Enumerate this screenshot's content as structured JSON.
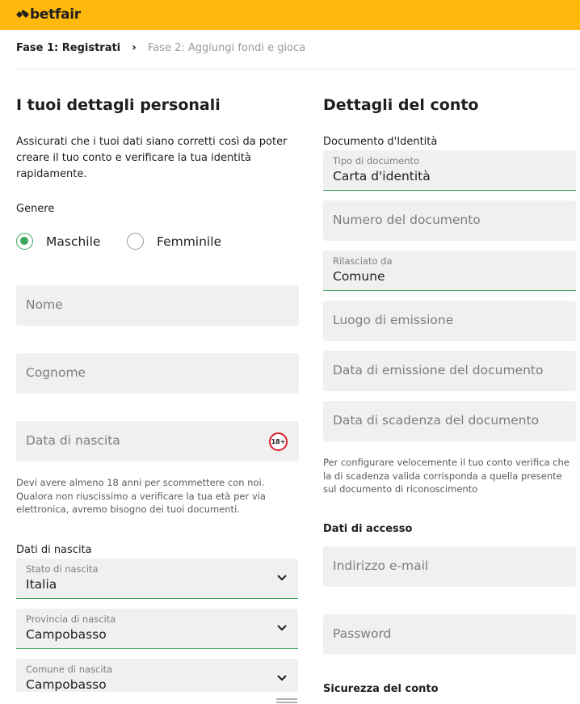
{
  "brand": {
    "name": "betfair"
  },
  "steps": {
    "step1": "Fase 1: Registrati",
    "step2": "Fase 2: Aggiungi fondi e gioca"
  },
  "personal": {
    "title": "I tuoi dettagli personali",
    "intro": "Assicurati che i tuoi dati siano corretti così da poter creare il tuo conto e verificare la tua identità rapidamente.",
    "gender_label": "Genere",
    "gender_options": [
      "Maschile",
      "Femminile"
    ],
    "gender_selected": "Maschile",
    "first_name_placeholder": "Nome",
    "last_name_placeholder": "Cognome",
    "birth_date_placeholder": "Data di nascita",
    "age_badge": "18+",
    "age_note": "Devi avere almeno 18 anni per scommettere con noi. Qualora non riuscissimo a verificare la tua età per via elettronica, avremo bisogno dei tuoi documenti.",
    "birth_data_title": "Dati di nascita",
    "birth_state_label": "Stato di nascita",
    "birth_state_value": "Italia",
    "birth_province_label": "Provincia di nascita",
    "birth_province_value": "Campobasso",
    "birth_city_label": "Comune di nascita",
    "birth_city_value": "Campobasso"
  },
  "account": {
    "title": "Dettagli del conto",
    "doc_section": "Documento d'Identità",
    "doc_type_label": "Tipo di documento",
    "doc_type_value": "Carta d'identità",
    "doc_number_placeholder": "Numero del documento",
    "issued_by_label": "Rilasciato da",
    "issued_by_value": "Comune",
    "issue_place_placeholder": "Luogo di emissione",
    "issue_date_placeholder": "Data di emissione del documento",
    "expiry_date_placeholder": "Data di scadenza del documento",
    "doc_note": "Per configurare velocemente il tuo conto verifica che la di scadenza valida corrisponda a quella presente sul documento di riconoscimento",
    "access_title": "Dati di accesso",
    "email_placeholder": "Indirizzo e-mail",
    "password_placeholder": "Password",
    "security_title": "Sicurezza del conto"
  },
  "colors": {
    "brand_yellow": "#ffb80c",
    "success_green": "#3aa55b",
    "badge_red": "#d8202a"
  }
}
